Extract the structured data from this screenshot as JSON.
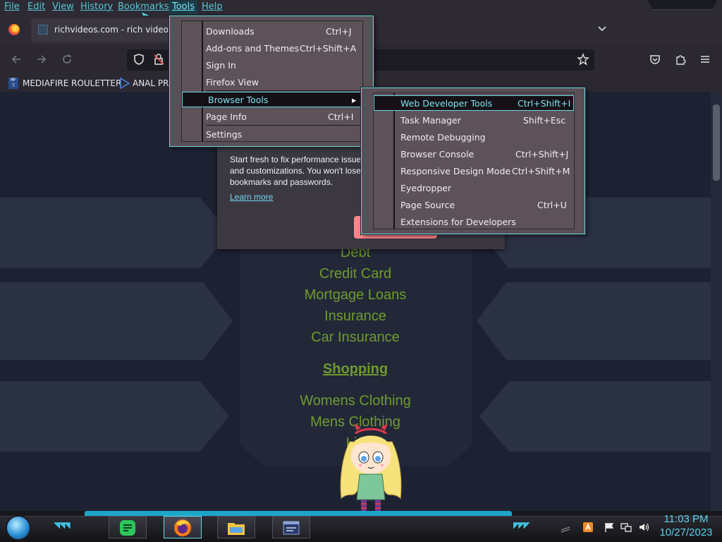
{
  "menubar": {
    "items": [
      "File",
      "Edit",
      "View",
      "History",
      "Bookmarks",
      "Tools",
      "Help"
    ]
  },
  "tab": {
    "title": "richvideos.com - rich videos R"
  },
  "bookmarks": {
    "items": [
      "MEDIAFIRE ROULETTER",
      "ANAL PRO"
    ],
    "icon_text": "MF\nT"
  },
  "tools_menu": {
    "items": [
      {
        "label": "Downloads",
        "accel": "Ctrl+J"
      },
      {
        "label": "Add-ons and Themes",
        "accel": "Ctrl+Shift+A"
      },
      {
        "label": "Sign In",
        "accel": ""
      },
      {
        "label": "Firefox View",
        "accel": ""
      },
      {
        "label": "Browser Tools",
        "accel": ""
      },
      {
        "label": "Page Info",
        "accel": "Ctrl+I"
      },
      {
        "label": "Settings",
        "accel": ""
      }
    ]
  },
  "dev_menu": {
    "items": [
      {
        "label": "Web Developer Tools",
        "accel": "Ctrl+Shift+I"
      },
      {
        "label": "Task Manager",
        "accel": "Shift+Esc"
      },
      {
        "label": "Remote Debugging",
        "accel": ""
      },
      {
        "label": "Browser Console",
        "accel": "Ctrl+Shift+J"
      },
      {
        "label": "Responsive Design Mode",
        "accel": "Ctrl+Shift+M"
      },
      {
        "label": "Eyedropper",
        "accel": ""
      },
      {
        "label": "Page Source",
        "accel": "Ctrl+U"
      },
      {
        "label": "Extensions for Developers",
        "accel": ""
      }
    ]
  },
  "notice": {
    "text": "Start fresh to fix performance issues and customizations. You won't lose bookmarks and passwords.",
    "link": "Learn more"
  },
  "page": {
    "links_top": [
      "Debt",
      "Credit Card",
      "Mortgage Loans",
      "Insurance",
      "Car Insurance"
    ],
    "heading": "Shopping",
    "links_bottom": [
      "Womens Clothing",
      "Mens Clothing",
      "Lin",
      "S"
    ]
  },
  "taskbar": {
    "time": "11:03 PM",
    "date": "10/27/2023"
  },
  "colors": {
    "accent": "#6bd8e6",
    "link_green": "#6f9a2d",
    "menu_bg": "#5d5259",
    "taskbar_accent": "#1ea6c9"
  }
}
